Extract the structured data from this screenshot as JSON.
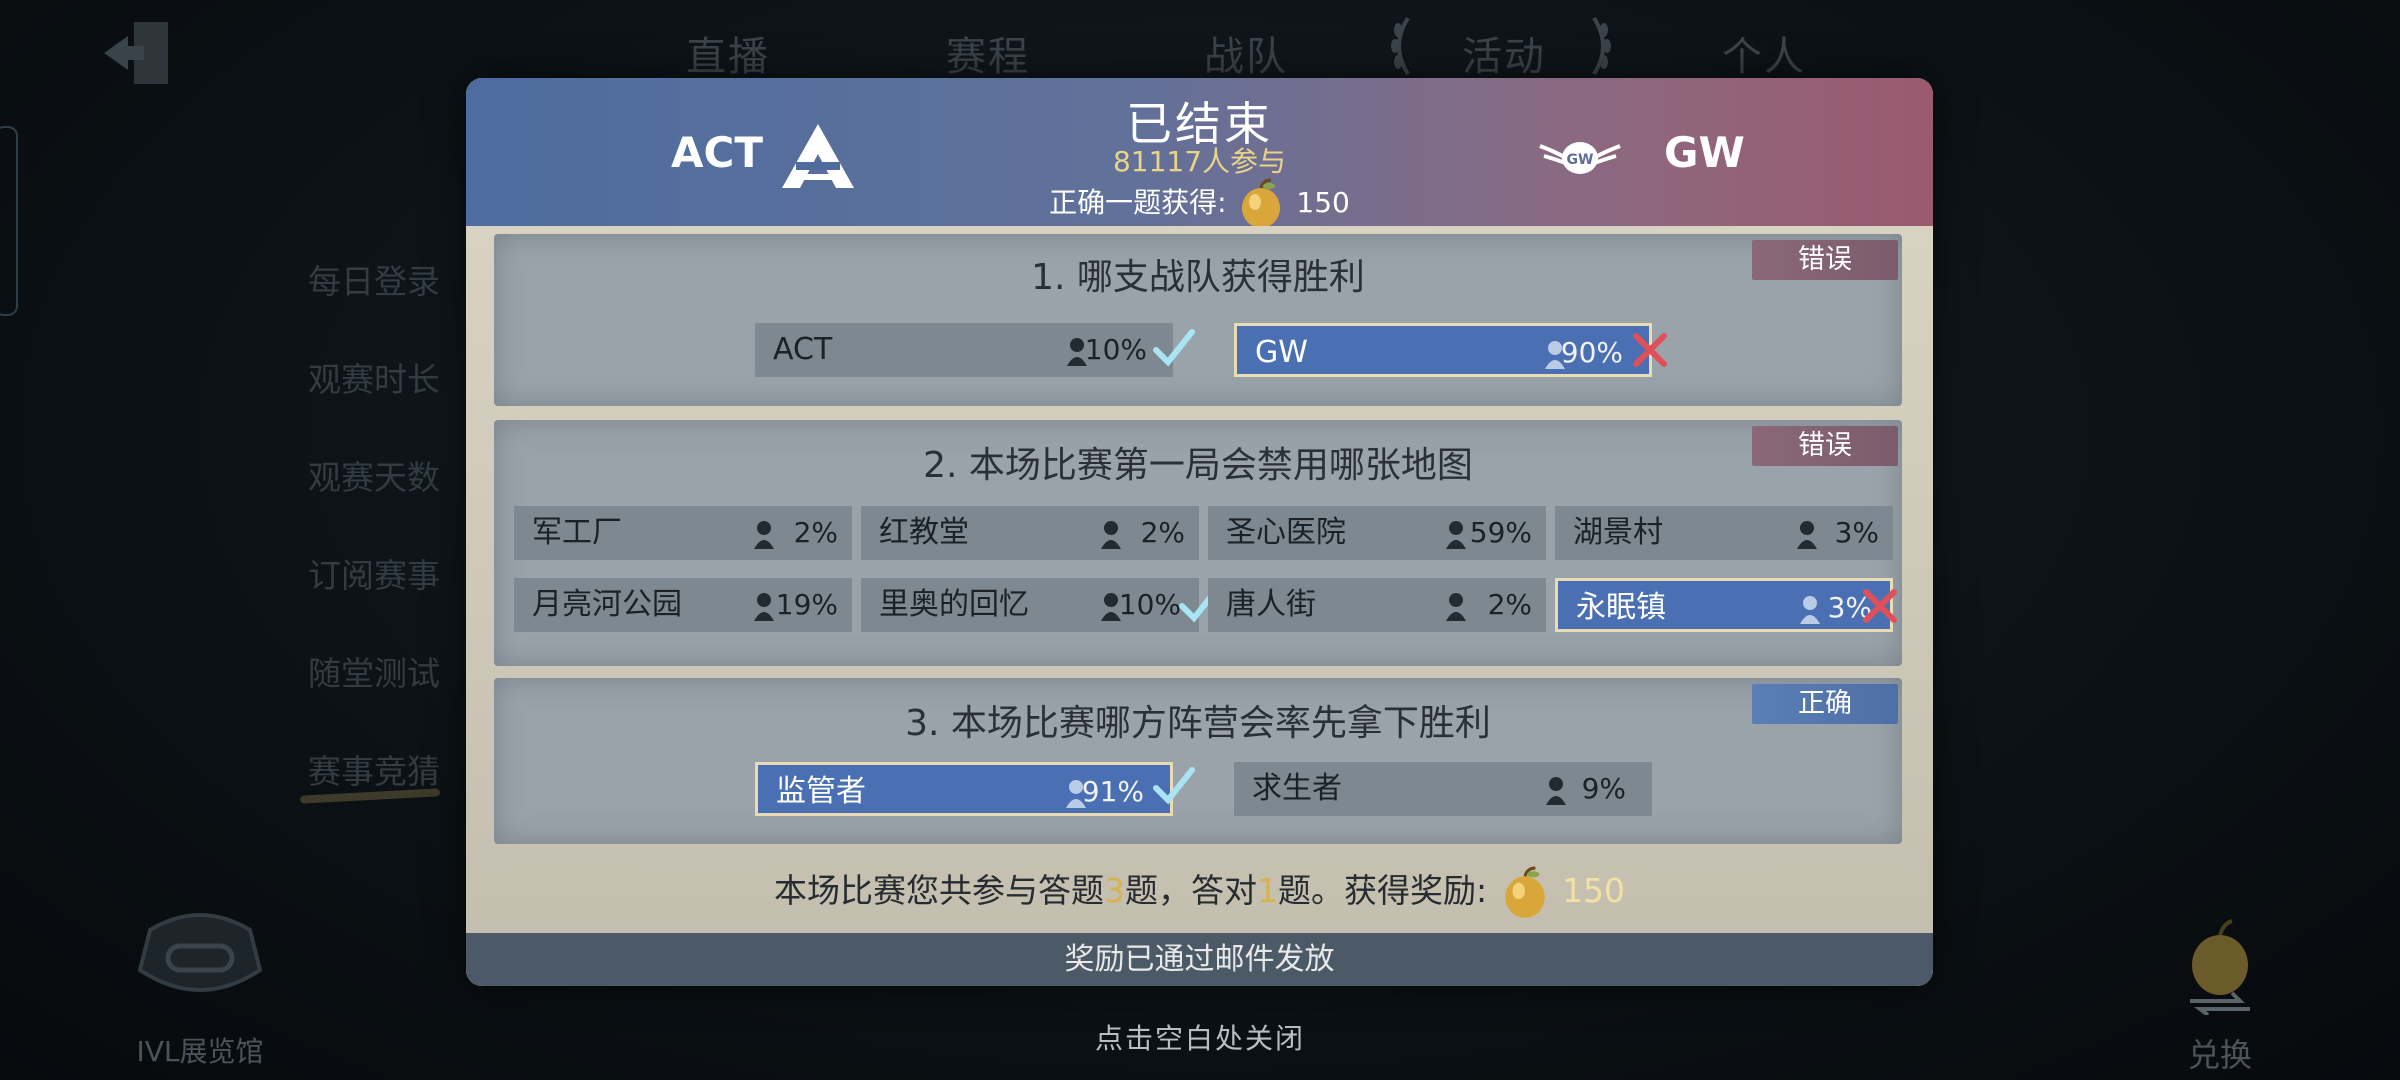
{
  "background": {
    "nav_tabs": [
      "直播",
      "赛程",
      "战队",
      "活动",
      "个人"
    ],
    "side_menu": [
      "每日登录",
      "观赛时长",
      "观赛天数",
      "订阅赛事",
      "随堂测试",
      "赛事竞猜"
    ],
    "museum_label": "IVL展览馆",
    "exchange_label": "兑换",
    "close_hint": "点击空白处关闭"
  },
  "modal": {
    "status": "已结束",
    "participants": "81117人参与",
    "reward_prefix": "正确一题获得:",
    "reward_amount": "150",
    "team_left": "ACT",
    "team_right": "GW",
    "questions": [
      {
        "title": "1.  哪支战队获得胜利",
        "verdict": "错误",
        "options": [
          {
            "label": "ACT",
            "pct": "10%",
            "selected": false,
            "correct": true
          },
          {
            "label": "GW",
            "pct": "90%",
            "selected": true,
            "correct": false
          }
        ]
      },
      {
        "title": "2.  本场比赛第一局会禁用哪张地图",
        "verdict": "错误",
        "options": [
          {
            "label": "军工厂",
            "pct": "2%",
            "selected": false,
            "correct": false
          },
          {
            "label": "红教堂",
            "pct": "2%",
            "selected": false,
            "correct": false
          },
          {
            "label": "圣心医院",
            "pct": "59%",
            "selected": false,
            "correct": false
          },
          {
            "label": "湖景村",
            "pct": "3%",
            "selected": false,
            "correct": false
          },
          {
            "label": "月亮河公园",
            "pct": "19%",
            "selected": false,
            "correct": false
          },
          {
            "label": "里奥的回忆",
            "pct": "10%",
            "selected": false,
            "correct": true
          },
          {
            "label": "唐人街",
            "pct": "2%",
            "selected": false,
            "correct": false
          },
          {
            "label": "永眠镇",
            "pct": "3%",
            "selected": true,
            "correct": false
          }
        ]
      },
      {
        "title": "3.  本场比赛哪方阵营会率先拿下胜利",
        "verdict": "正确",
        "options": [
          {
            "label": "监管者",
            "pct": "91%",
            "selected": true,
            "correct": true
          },
          {
            "label": "求生者",
            "pct": "9%",
            "selected": false,
            "correct": false
          }
        ]
      }
    ],
    "summary": {
      "part1": "本场比赛您共参与答题",
      "answered": "3",
      "part2": "题，答对",
      "correct": "1",
      "part3": "题。获得奖励:",
      "amount": "150"
    },
    "mail_notice": "奖励已通过邮件发放"
  },
  "colors": {
    "selected_option": "#4a70b3",
    "option": "#7d8890",
    "verdict_wrong": "#8a6878",
    "verdict_right": "#5b7eb6",
    "check": "#a8e4f4",
    "cross": "#e0505a"
  }
}
